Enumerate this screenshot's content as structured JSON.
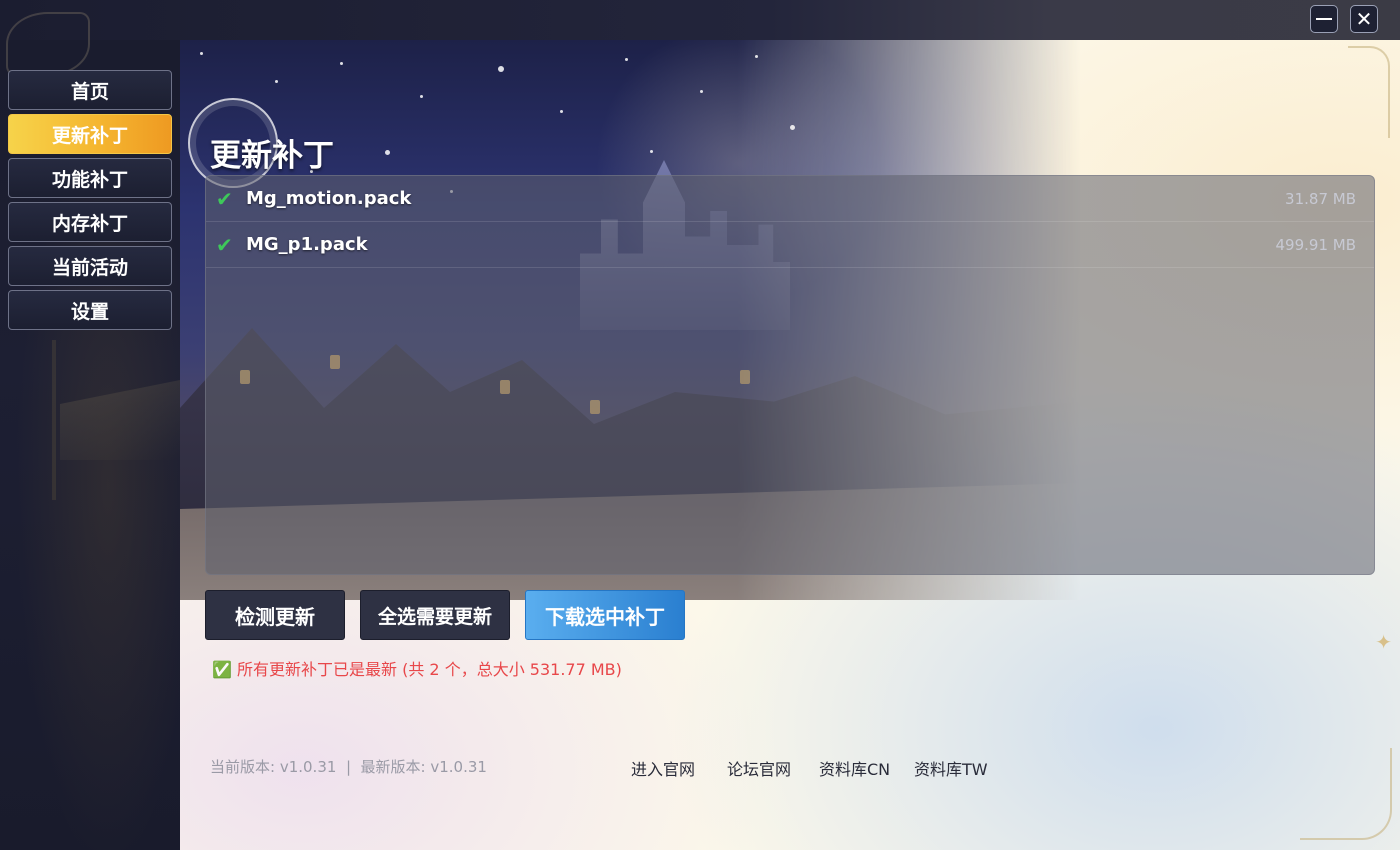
{
  "window": {
    "minimize_glyph": "—",
    "close_glyph": "✕"
  },
  "sidebar": {
    "items": [
      {
        "label": "首页",
        "active": false
      },
      {
        "label": "更新补丁",
        "active": true
      },
      {
        "label": "功能补丁",
        "active": false
      },
      {
        "label": "内存补丁",
        "active": false
      },
      {
        "label": "当前活动",
        "active": false
      },
      {
        "label": "设置",
        "active": false
      }
    ]
  },
  "main": {
    "title": "更新补丁",
    "files": [
      {
        "name": "Mg_motion.pack",
        "size": "31.87 MB",
        "checked": true
      },
      {
        "name": "MG_p1.pack",
        "size": "499.91 MB",
        "checked": true
      }
    ],
    "check_glyph": "✔",
    "buttons": {
      "check_updates": "检测更新",
      "select_needed": "全选需要更新",
      "download_selected": "下载选中补丁"
    },
    "status": "✅ 所有更新补丁已是最新 (共 2 个，总大小 531.77 MB)",
    "status_color": "#e8474a"
  },
  "footer": {
    "version_text": "当前版本: v1.0.31  |  最新版本: v1.0.31",
    "links": [
      "进入官网",
      "论坛官网",
      "资料库CN",
      "资料库TW"
    ]
  },
  "colors": {
    "accent_active": "#f5b630",
    "download_button": "#3a92de",
    "check_green": "#3ec85a"
  }
}
